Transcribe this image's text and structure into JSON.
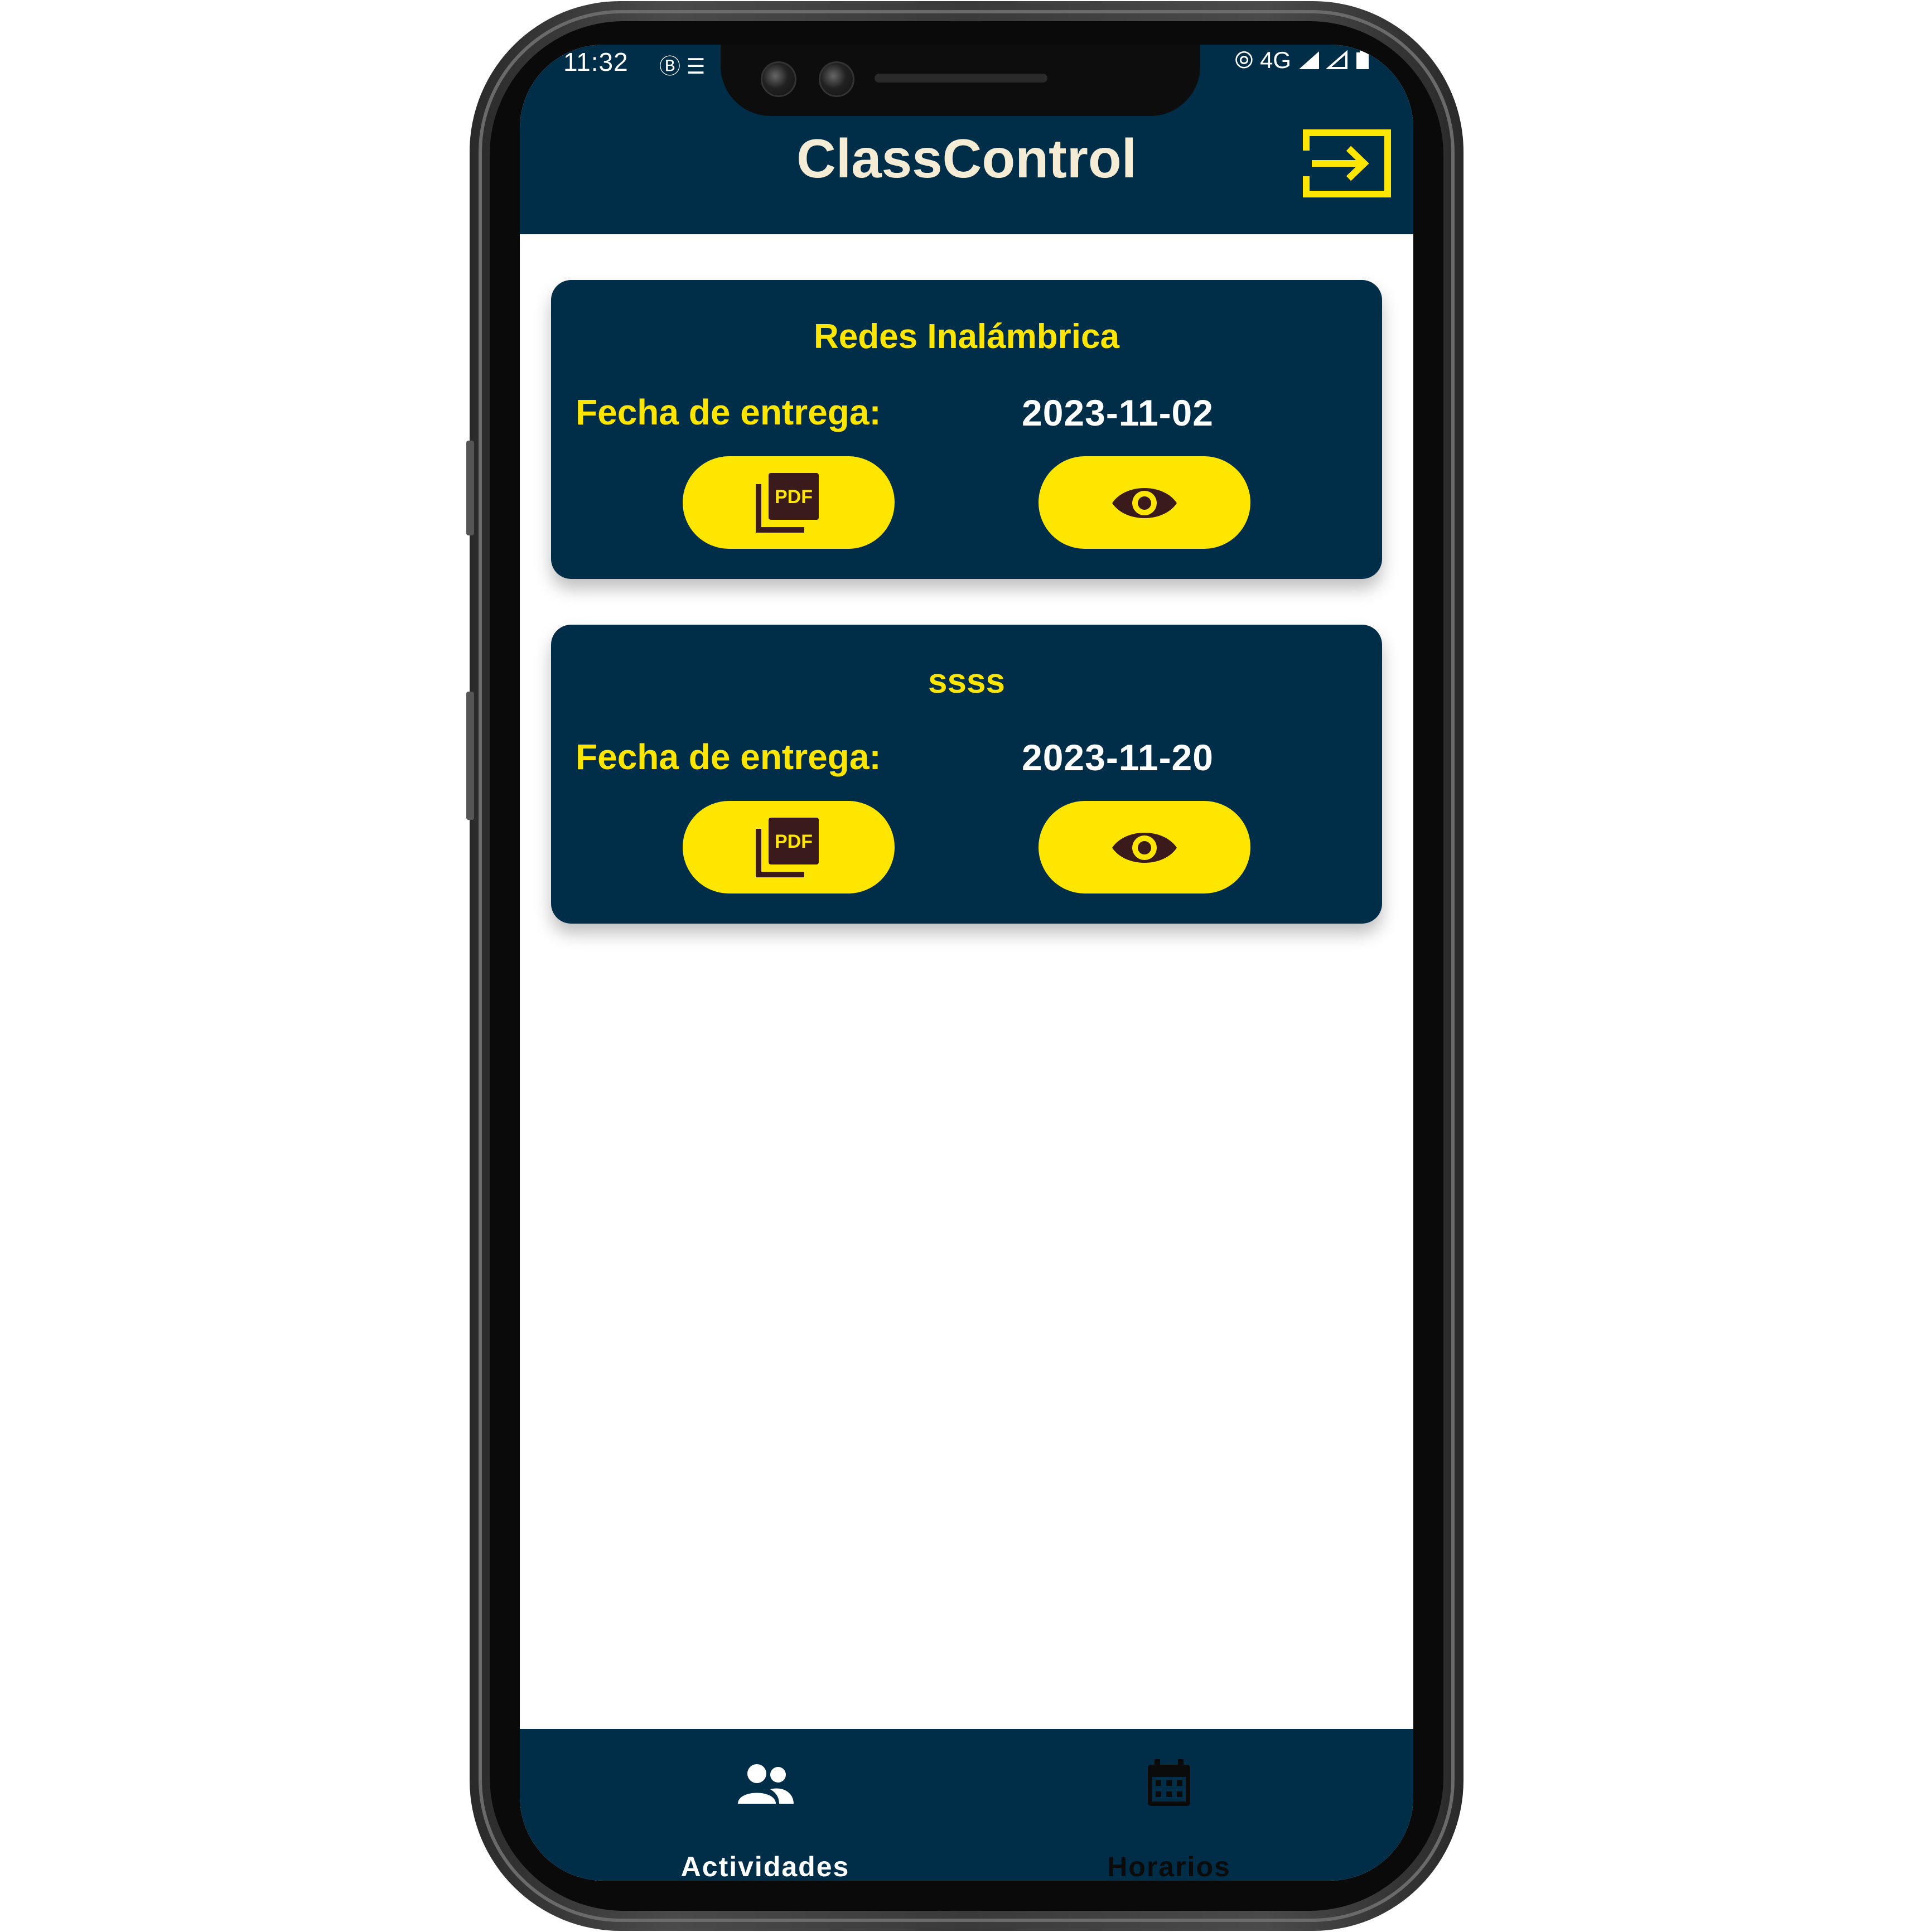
{
  "status_bar": {
    "time": "11:32",
    "left_icons": "Ⓑ ☰",
    "network": "4G"
  },
  "header": {
    "title": "ClassControl",
    "logout_icon": "logout-icon"
  },
  "assignments": [
    {
      "name": "Redes Inalámbrica",
      "due_label": "Fecha de entrega:",
      "due_date": "2023-11-02",
      "pdf_icon": "pdf-icon",
      "view_icon": "eye-icon"
    },
    {
      "name": "ssss",
      "due_label": "Fecha de entrega:",
      "due_date": "2023-11-20",
      "pdf_icon": "pdf-icon",
      "view_icon": "eye-icon"
    }
  ],
  "bottom_nav": {
    "items": [
      {
        "label": "Actividades",
        "icon": "group-icon",
        "active": true
      },
      {
        "label": "Horarios",
        "icon": "calendar-icon",
        "active": false
      }
    ]
  },
  "colors": {
    "primary_navy": "#002d47",
    "accent_yellow": "#ffe600",
    "title_cream": "#f5ecd6",
    "icon_dark": "#3a1a1a"
  }
}
